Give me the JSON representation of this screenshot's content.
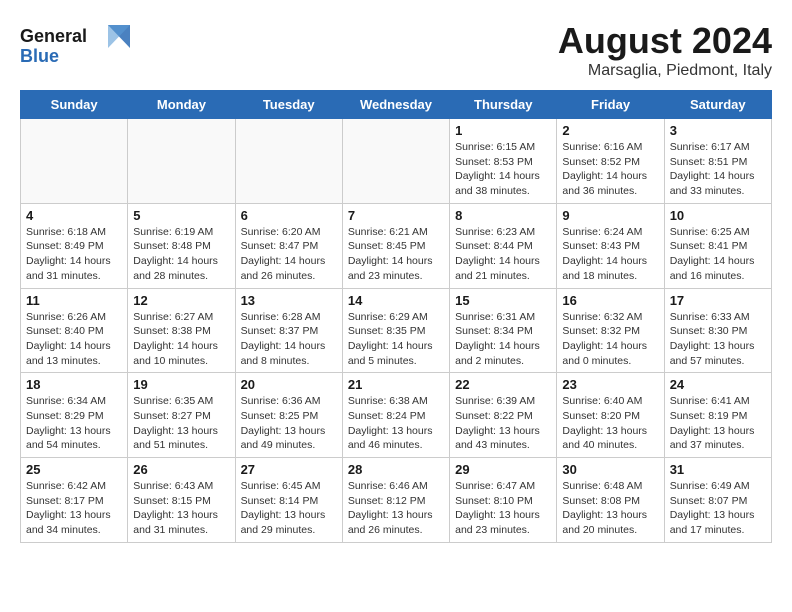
{
  "header": {
    "logo_general": "General",
    "logo_blue": "Blue",
    "month_year": "August 2024",
    "location": "Marsaglia, Piedmont, Italy"
  },
  "days_of_week": [
    "Sunday",
    "Monday",
    "Tuesday",
    "Wednesday",
    "Thursday",
    "Friday",
    "Saturday"
  ],
  "weeks": [
    [
      {
        "day": "",
        "info": ""
      },
      {
        "day": "",
        "info": ""
      },
      {
        "day": "",
        "info": ""
      },
      {
        "day": "",
        "info": ""
      },
      {
        "day": "1",
        "info": "Sunrise: 6:15 AM\nSunset: 8:53 PM\nDaylight: 14 hours\nand 38 minutes."
      },
      {
        "day": "2",
        "info": "Sunrise: 6:16 AM\nSunset: 8:52 PM\nDaylight: 14 hours\nand 36 minutes."
      },
      {
        "day": "3",
        "info": "Sunrise: 6:17 AM\nSunset: 8:51 PM\nDaylight: 14 hours\nand 33 minutes."
      }
    ],
    [
      {
        "day": "4",
        "info": "Sunrise: 6:18 AM\nSunset: 8:49 PM\nDaylight: 14 hours\nand 31 minutes."
      },
      {
        "day": "5",
        "info": "Sunrise: 6:19 AM\nSunset: 8:48 PM\nDaylight: 14 hours\nand 28 minutes."
      },
      {
        "day": "6",
        "info": "Sunrise: 6:20 AM\nSunset: 8:47 PM\nDaylight: 14 hours\nand 26 minutes."
      },
      {
        "day": "7",
        "info": "Sunrise: 6:21 AM\nSunset: 8:45 PM\nDaylight: 14 hours\nand 23 minutes."
      },
      {
        "day": "8",
        "info": "Sunrise: 6:23 AM\nSunset: 8:44 PM\nDaylight: 14 hours\nand 21 minutes."
      },
      {
        "day": "9",
        "info": "Sunrise: 6:24 AM\nSunset: 8:43 PM\nDaylight: 14 hours\nand 18 minutes."
      },
      {
        "day": "10",
        "info": "Sunrise: 6:25 AM\nSunset: 8:41 PM\nDaylight: 14 hours\nand 16 minutes."
      }
    ],
    [
      {
        "day": "11",
        "info": "Sunrise: 6:26 AM\nSunset: 8:40 PM\nDaylight: 14 hours\nand 13 minutes."
      },
      {
        "day": "12",
        "info": "Sunrise: 6:27 AM\nSunset: 8:38 PM\nDaylight: 14 hours\nand 10 minutes."
      },
      {
        "day": "13",
        "info": "Sunrise: 6:28 AM\nSunset: 8:37 PM\nDaylight: 14 hours\nand 8 minutes."
      },
      {
        "day": "14",
        "info": "Sunrise: 6:29 AM\nSunset: 8:35 PM\nDaylight: 14 hours\nand 5 minutes."
      },
      {
        "day": "15",
        "info": "Sunrise: 6:31 AM\nSunset: 8:34 PM\nDaylight: 14 hours\nand 2 minutes."
      },
      {
        "day": "16",
        "info": "Sunrise: 6:32 AM\nSunset: 8:32 PM\nDaylight: 14 hours\nand 0 minutes."
      },
      {
        "day": "17",
        "info": "Sunrise: 6:33 AM\nSunset: 8:30 PM\nDaylight: 13 hours\nand 57 minutes."
      }
    ],
    [
      {
        "day": "18",
        "info": "Sunrise: 6:34 AM\nSunset: 8:29 PM\nDaylight: 13 hours\nand 54 minutes."
      },
      {
        "day": "19",
        "info": "Sunrise: 6:35 AM\nSunset: 8:27 PM\nDaylight: 13 hours\nand 51 minutes."
      },
      {
        "day": "20",
        "info": "Sunrise: 6:36 AM\nSunset: 8:25 PM\nDaylight: 13 hours\nand 49 minutes."
      },
      {
        "day": "21",
        "info": "Sunrise: 6:38 AM\nSunset: 8:24 PM\nDaylight: 13 hours\nand 46 minutes."
      },
      {
        "day": "22",
        "info": "Sunrise: 6:39 AM\nSunset: 8:22 PM\nDaylight: 13 hours\nand 43 minutes."
      },
      {
        "day": "23",
        "info": "Sunrise: 6:40 AM\nSunset: 8:20 PM\nDaylight: 13 hours\nand 40 minutes."
      },
      {
        "day": "24",
        "info": "Sunrise: 6:41 AM\nSunset: 8:19 PM\nDaylight: 13 hours\nand 37 minutes."
      }
    ],
    [
      {
        "day": "25",
        "info": "Sunrise: 6:42 AM\nSunset: 8:17 PM\nDaylight: 13 hours\nand 34 minutes."
      },
      {
        "day": "26",
        "info": "Sunrise: 6:43 AM\nSunset: 8:15 PM\nDaylight: 13 hours\nand 31 minutes."
      },
      {
        "day": "27",
        "info": "Sunrise: 6:45 AM\nSunset: 8:14 PM\nDaylight: 13 hours\nand 29 minutes."
      },
      {
        "day": "28",
        "info": "Sunrise: 6:46 AM\nSunset: 8:12 PM\nDaylight: 13 hours\nand 26 minutes."
      },
      {
        "day": "29",
        "info": "Sunrise: 6:47 AM\nSunset: 8:10 PM\nDaylight: 13 hours\nand 23 minutes."
      },
      {
        "day": "30",
        "info": "Sunrise: 6:48 AM\nSunset: 8:08 PM\nDaylight: 13 hours\nand 20 minutes."
      },
      {
        "day": "31",
        "info": "Sunrise: 6:49 AM\nSunset: 8:07 PM\nDaylight: 13 hours\nand 17 minutes."
      }
    ]
  ]
}
